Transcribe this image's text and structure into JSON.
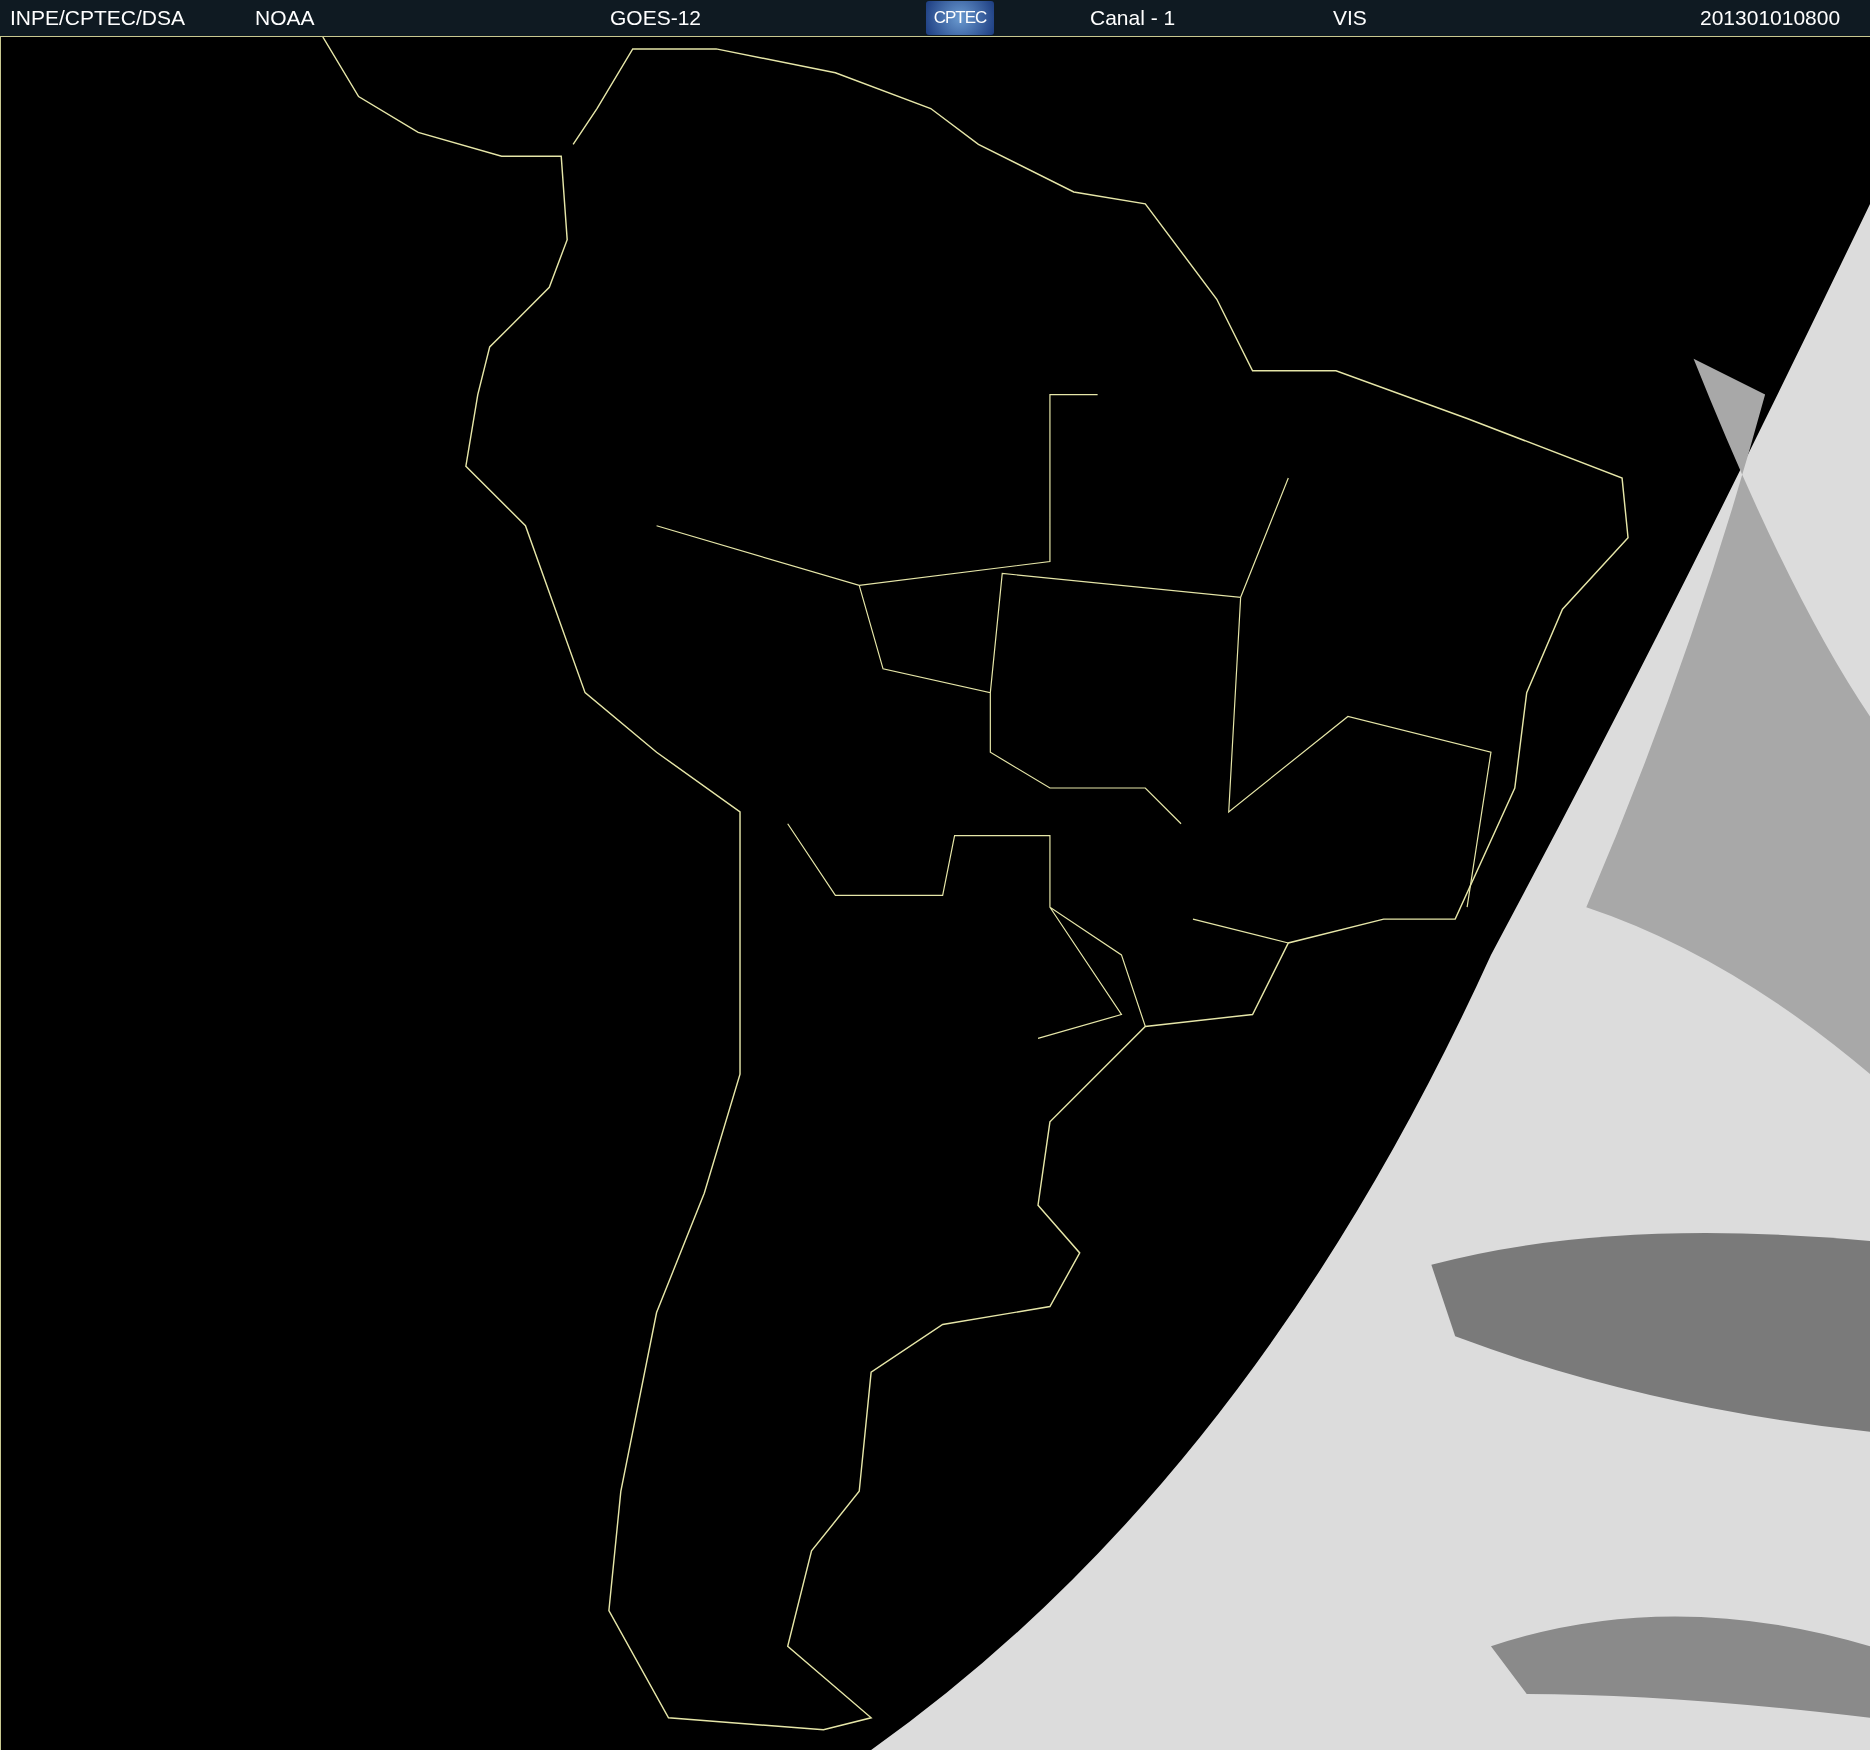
{
  "header": {
    "items": [
      {
        "kind": "text",
        "text": "INPE/CPTEC/DSA"
      },
      {
        "kind": "text",
        "text": "NOAA"
      },
      {
        "kind": "text",
        "text": "GOES-12"
      },
      {
        "kind": "logo",
        "text": "CPTEC"
      },
      {
        "kind": "text",
        "text": "Canal - 1"
      },
      {
        "kind": "text",
        "text": "VIS"
      },
      {
        "kind": "text",
        "text": "201301010800"
      }
    ]
  }
}
